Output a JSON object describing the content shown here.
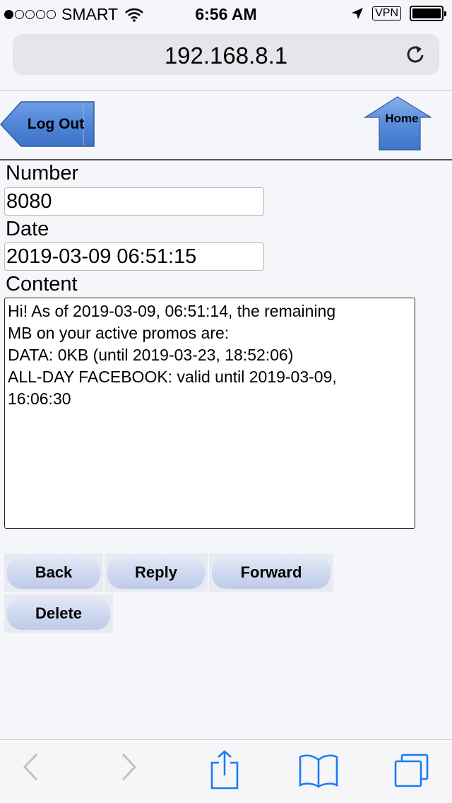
{
  "status_bar": {
    "carrier": "SMART",
    "time": "6:56 AM",
    "vpn": "VPN",
    "signal_bars_filled": 1,
    "signal_bars_total": 5
  },
  "browser": {
    "url": "192.168.8.1"
  },
  "header": {
    "logout_label": "Log Out",
    "home_label": "Home"
  },
  "form": {
    "number_label": "Number",
    "number_value": "8080",
    "date_label": "Date",
    "date_value": "2019-03-09 06:51:15",
    "content_label": "Content",
    "content_value": "Hi! As of 2019-03-09, 06:51:14, the remaining\nMB on your active promos are:\nDATA: 0KB (until 2019-03-23, 18:52:06)\nALL-DAY FACEBOOK: valid until 2019-03-09,\n16:06:30"
  },
  "actions": {
    "back_label": "Back",
    "reply_label": "Reply",
    "forward_label": "Forward",
    "delete_label": "Delete"
  },
  "toolbar": {
    "items": [
      "back-arrow-icon",
      "forward-arrow-icon",
      "share-icon",
      "bookmarks-icon",
      "tabs-icon"
    ]
  },
  "colors": {
    "accent": "#1a7cf5",
    "button_blue": "#4f86d6",
    "page_bg": "#f5f6fa"
  }
}
